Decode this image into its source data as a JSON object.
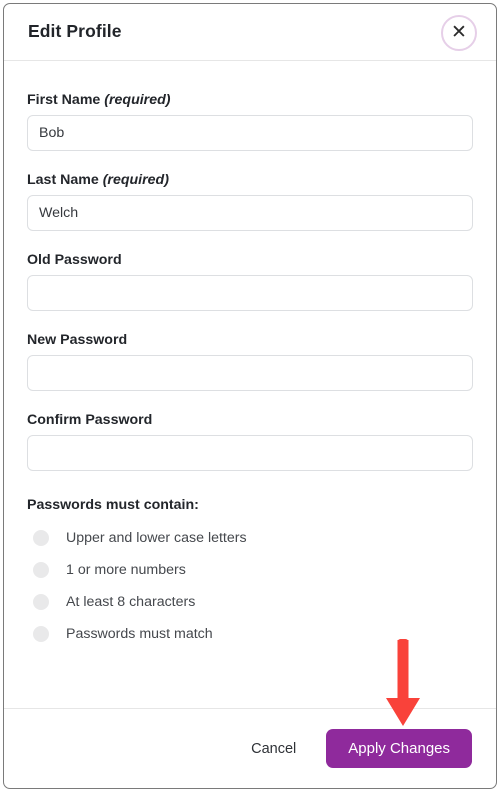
{
  "modal": {
    "title": "Edit Profile",
    "close_icon": "close-icon",
    "close_glyph": "✕"
  },
  "form": {
    "fields": [
      {
        "name": "first-name",
        "label": "First Name",
        "required_text": "(required)",
        "value": "Bob",
        "placeholder": "",
        "type": "text"
      },
      {
        "name": "last-name",
        "label": "Last Name",
        "required_text": "(required)",
        "value": "Welch",
        "placeholder": "",
        "type": "text"
      },
      {
        "name": "old-password",
        "label": "Old Password",
        "required_text": "",
        "value": "",
        "placeholder": "",
        "type": "password"
      },
      {
        "name": "new-password",
        "label": "New Password",
        "required_text": "",
        "value": "",
        "placeholder": "",
        "type": "password"
      },
      {
        "name": "confirm-password",
        "label": "Confirm Password",
        "required_text": "",
        "value": "",
        "placeholder": "",
        "type": "password"
      }
    ]
  },
  "requirements": {
    "title": "Passwords must contain:",
    "items": [
      "Upper and lower case letters",
      "1 or more numbers",
      "At least 8 characters",
      "Passwords must match"
    ]
  },
  "footer": {
    "cancel_label": "Cancel",
    "apply_label": "Apply Changes"
  },
  "colors": {
    "accent_purple": "#8f2a9c",
    "close_ring": "#e6cfe8",
    "annotation_red": "#f9423a",
    "sidebar_navy": "#1f4269",
    "requirement_dot": "#e9e9ea"
  },
  "annotation": {
    "arrow_icon": "down-arrow-icon",
    "direction": "down",
    "points_at": "Apply Changes"
  }
}
